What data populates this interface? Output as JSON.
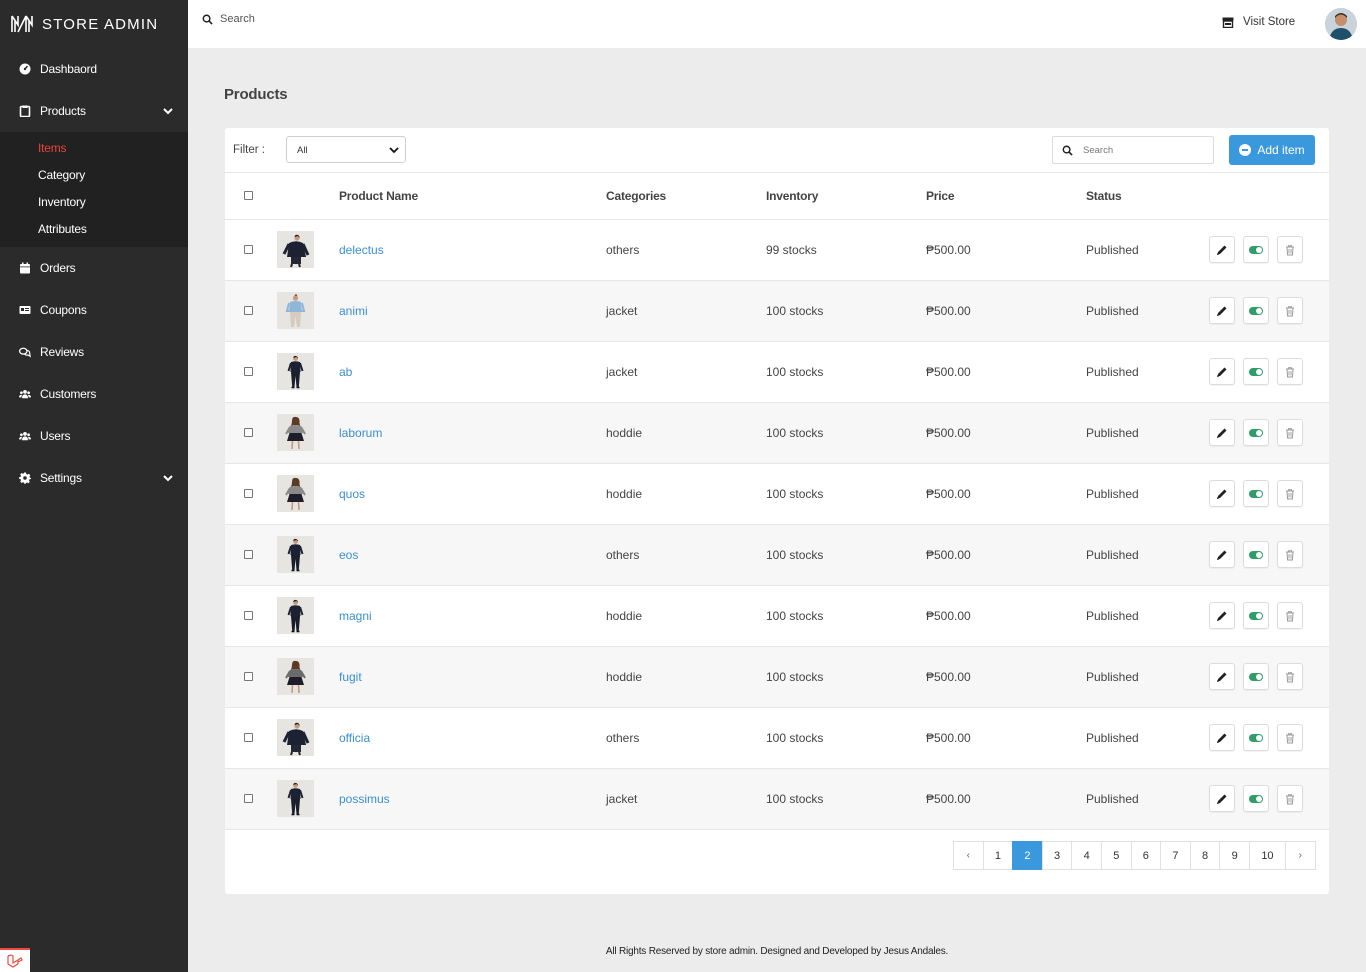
{
  "app": {
    "brand": "STORE ADMIN"
  },
  "sidebar": {
    "items": [
      {
        "key": "dashboard",
        "label": "Dashbaord",
        "icon": "dashboard-gauge-icon"
      },
      {
        "key": "products",
        "label": "Products",
        "icon": "clipboard-icon",
        "expanded": true,
        "children": [
          {
            "label": "Items",
            "active": true
          },
          {
            "label": "Category"
          },
          {
            "label": "Inventory"
          },
          {
            "label": "Attributes"
          }
        ]
      },
      {
        "key": "orders",
        "label": "Orders",
        "icon": "calendar-icon"
      },
      {
        "key": "coupons",
        "label": "Coupons",
        "icon": "id-card-icon"
      },
      {
        "key": "reviews",
        "label": "Reviews",
        "icon": "comments-icon"
      },
      {
        "key": "customers",
        "label": "Customers",
        "icon": "users-icon"
      },
      {
        "key": "users",
        "label": "Users",
        "icon": "users-icon"
      },
      {
        "key": "settings",
        "label": "Settings",
        "icon": "gear-icon",
        "expandable": true
      }
    ]
  },
  "topbar": {
    "search_label": "Search",
    "visit_store_label": "Visit Store"
  },
  "page": {
    "title": "Products"
  },
  "filter": {
    "label": "Filter :",
    "selected": "All",
    "search_placeholder": "Search",
    "add_button_label": "Add item"
  },
  "table": {
    "headers": [
      "Product Name",
      "Categories",
      "Inventory",
      "Price",
      "Status"
    ],
    "rows": [
      {
        "name": "delectus",
        "category": "others",
        "inventory": "99 stocks",
        "price": "₱500.00",
        "status": "Published",
        "figure": "dark-jacket"
      },
      {
        "name": "animi",
        "category": "jacket",
        "inventory": "100 stocks",
        "price": "₱500.00",
        "status": "Published",
        "figure": "light-blue"
      },
      {
        "name": "ab",
        "category": "jacket",
        "inventory": "100 stocks",
        "price": "₱500.00",
        "status": "Published",
        "figure": "dark-suit"
      },
      {
        "name": "laborum",
        "category": "hoddie",
        "inventory": "100 stocks",
        "price": "₱500.00",
        "status": "Published",
        "figure": "woman-skirt"
      },
      {
        "name": "quos",
        "category": "hoddie",
        "inventory": "100 stocks",
        "price": "₱500.00",
        "status": "Published",
        "figure": "woman-skirt"
      },
      {
        "name": "eos",
        "category": "others",
        "inventory": "100 stocks",
        "price": "₱500.00",
        "status": "Published",
        "figure": "dark-suit"
      },
      {
        "name": "magni",
        "category": "hoddie",
        "inventory": "100 stocks",
        "price": "₱500.00",
        "status": "Published",
        "figure": "dark-suit"
      },
      {
        "name": "fugit",
        "category": "hoddie",
        "inventory": "100 stocks",
        "price": "₱500.00",
        "status": "Published",
        "figure": "woman-grey"
      },
      {
        "name": "officia",
        "category": "others",
        "inventory": "100 stocks",
        "price": "₱500.00",
        "status": "Published",
        "figure": "dark-jacket"
      },
      {
        "name": "possimus",
        "category": "jacket",
        "inventory": "100 stocks",
        "price": "₱500.00",
        "status": "Published",
        "figure": "dark-suit"
      }
    ]
  },
  "pagination": {
    "prev": "‹",
    "next": "›",
    "pages": [
      "1",
      "2",
      "3",
      "4",
      "5",
      "6",
      "7",
      "8",
      "9",
      "10"
    ],
    "current": "2"
  },
  "footer": {
    "text": "All Rights Reserved by store admin. Designed and Developed by Jesus Andales."
  },
  "colors": {
    "sidebar_bg": "#2b2b2b",
    "accent_blue": "#3a98dc",
    "active_red": "#e9433b",
    "toggle_green": "#2f9c6a"
  }
}
